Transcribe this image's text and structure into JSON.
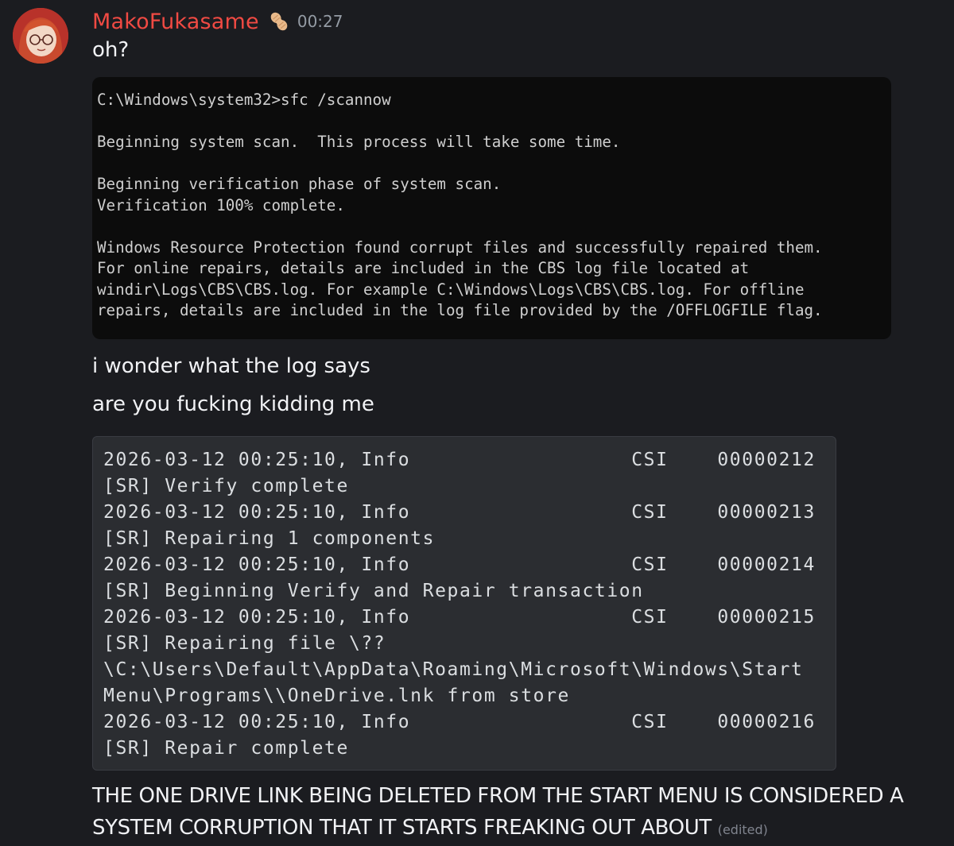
{
  "message": {
    "author": "MakoFukasame",
    "time": "00:27",
    "role_icon": "peanut-icon",
    "colors": {
      "author": "#f04a43",
      "background": "#1b1c20",
      "code_bg": "#2b2d31"
    }
  },
  "lines": {
    "oh": "oh?",
    "wonder": "i wonder what the log says",
    "kidding": "are you fucking kidding me",
    "caps": "THE ONE DRIVE LINK BEING DELETED FROM THE START MENU IS CONSIDERED A SYSTEM CORRUPTION THAT IT STARTS FREAKING OUT ABOUT",
    "edited": "(edited)"
  },
  "terminal": [
    "C:\\Windows\\system32>sfc /scannow",
    "",
    "Beginning system scan.  This process will take some time.",
    "",
    "Beginning verification phase of system scan.",
    "Verification 100% complete.",
    "",
    "Windows Resource Protection found corrupt files and successfully repaired them.",
    "For online repairs, details are included in the CBS log file located at",
    "windir\\Logs\\CBS\\CBS.log. For example C:\\Windows\\Logs\\CBS\\CBS.log. For offline",
    "repairs, details are included in the log file provided by the /OFFLOGFILE flag."
  ],
  "log": [
    "2026-03-12 00:25:10, Info                  CSI    00000212",
    "[SR] Verify complete",
    "2026-03-12 00:25:10, Info                  CSI    00000213",
    "[SR] Repairing 1 components",
    "2026-03-12 00:25:10, Info                  CSI    00000214",
    "[SR] Beginning Verify and Repair transaction",
    "2026-03-12 00:25:10, Info                  CSI    00000215",
    "[SR] Repairing file \\??",
    "\\C:\\Users\\Default\\AppData\\Roaming\\Microsoft\\Windows\\Start",
    "Menu\\Programs\\\\OneDrive.lnk from store",
    "2026-03-12 00:25:10, Info                  CSI    00000216",
    "[SR] Repair complete"
  ]
}
